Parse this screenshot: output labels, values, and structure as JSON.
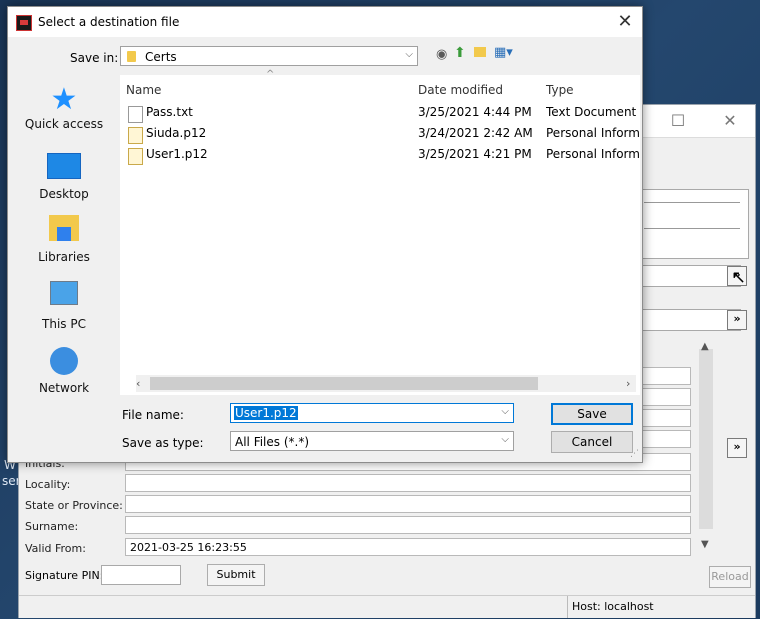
{
  "desktop": {
    "labels": [
      "W",
      "ser"
    ]
  },
  "background_window": {
    "form_fields": [
      {
        "label": "Initials:",
        "value": ""
      },
      {
        "label": "Locality:",
        "value": ""
      },
      {
        "label": "State or Province:",
        "value": ""
      },
      {
        "label": "Surname:",
        "value": ""
      },
      {
        "label": "Valid From:",
        "value": "2021-03-25 16:23:55"
      }
    ],
    "signature_pin_label": "Signature PIN:",
    "signature_pin_value": "",
    "submit_label": "Submit",
    "reload_label": "Reload",
    "status_host": "Host: localhost",
    "arrow_glyph": "»"
  },
  "dialog": {
    "title": "Select a destination file",
    "save_in_label": "Save in:",
    "save_in_value": "Certs",
    "sidebar": [
      {
        "label": "Quick access",
        "icon": "star-icon"
      },
      {
        "label": "Desktop",
        "icon": "desktop-icon"
      },
      {
        "label": "Libraries",
        "icon": "libraries-icon"
      },
      {
        "label": "This PC",
        "icon": "computer-icon"
      },
      {
        "label": "Network",
        "icon": "network-icon"
      }
    ],
    "columns": [
      "Name",
      "Date modified",
      "Type"
    ],
    "files": [
      {
        "name": "Pass.txt",
        "date": "3/25/2021 4:44 PM",
        "type": "Text Document",
        "icon": "text-file-icon"
      },
      {
        "name": "Siuda.p12",
        "date": "3/24/2021 2:42 AM",
        "type": "Personal Inform",
        "icon": "certificate-file-icon"
      },
      {
        "name": "User1.p12",
        "date": "3/25/2021 4:21 PM",
        "type": "Personal Inform",
        "icon": "certificate-file-icon"
      }
    ],
    "file_name_label": "File name:",
    "file_name_value": "User1.p12",
    "save_as_type_label": "Save as type:",
    "save_as_type_value": "All Files (*.*)",
    "save_label": "Save",
    "cancel_label": "Cancel"
  },
  "colors": {
    "selection": "#0078d7",
    "folder": "#f2c94c"
  }
}
